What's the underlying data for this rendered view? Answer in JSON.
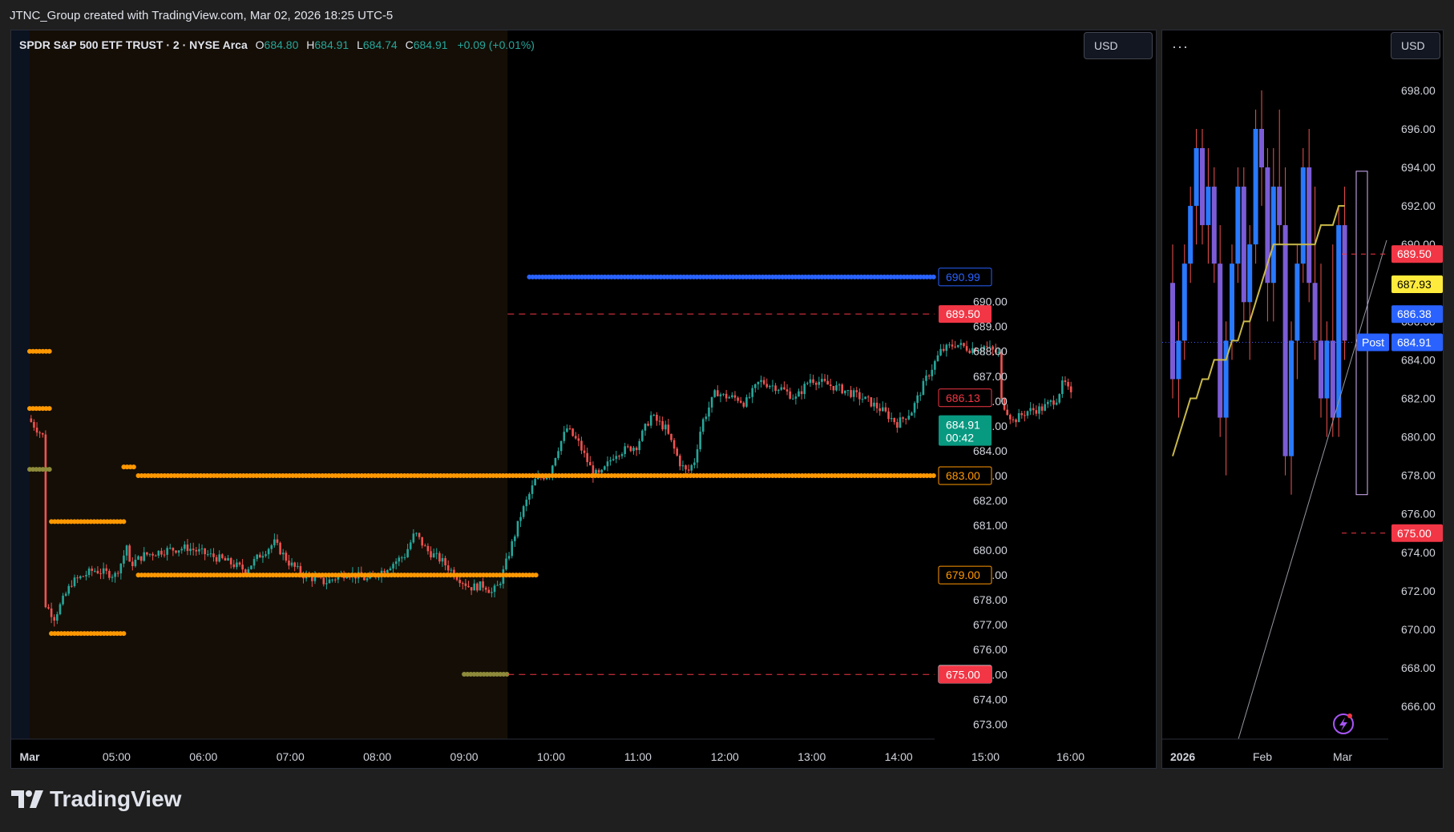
{
  "header": {
    "attribution": "JTNC_Group created with TradingView.com, Mar 02, 2026 18:25 UTC-5"
  },
  "main": {
    "symbol": "SPDR S&P 500 ETF TRUST · 2 · NYSE Arca",
    "o_label": "O",
    "o_value": "684.80",
    "h_label": "H",
    "h_value": "684.91",
    "l_label": "L",
    "l_value": "684.74",
    "c_label": "C",
    "c_value": "684.91",
    "change": "+0.09 (+0.01%)",
    "currency": "USD"
  },
  "side": {
    "menu": "···",
    "currency": "USD"
  },
  "footer": {
    "brand": "TradingView"
  },
  "colors": {
    "up": "#26a69a",
    "down": "#ef5350",
    "orange": "#ff9800",
    "blue": "#2962ff",
    "olive": "#8d8a3a",
    "red_label": "#f23645",
    "green_label": "#089981",
    "premarket_bg": "#140e06",
    "side_up": "#2979ff",
    "side_down": "#7b5cd6",
    "ma": "#c9b94a"
  },
  "chart_data": [
    {
      "type": "candlestick",
      "interval": "2",
      "ylim": [
        672.4,
        700.2
      ],
      "x_range": [
        "04:00",
        "16:00"
      ],
      "x_ticks": [
        "Mar",
        "05:00",
        "06:00",
        "07:00",
        "08:00",
        "09:00",
        "10:00",
        "11:00",
        "12:00",
        "13:00",
        "14:00",
        "15:00",
        "16:00"
      ],
      "y_ticks": [
        673,
        674,
        675,
        676,
        677,
        678,
        679,
        680,
        681,
        682,
        683,
        684,
        685,
        686,
        687,
        688,
        689,
        690
      ],
      "y_tick_labels": [
        "673.00",
        "674.00",
        "675.00",
        "676.00",
        "677.00",
        "678.00",
        "679.00",
        "680.00",
        "681.00",
        "682.00",
        "683.00",
        "684.00",
        "685.00",
        "686.00",
        "687.00",
        "688.00",
        "689.00",
        "690.00"
      ],
      "premarket_until": "09:30",
      "price_path": [
        [
          "04:00",
          685.3
        ],
        [
          "04:10",
          684.6
        ],
        [
          "04:12",
          677.8
        ],
        [
          "04:18",
          677.3
        ],
        [
          "04:30",
          678.7
        ],
        [
          "04:45",
          679.2
        ],
        [
          "05:00",
          679.0
        ],
        [
          "05:05",
          679.6
        ],
        [
          "05:08",
          680.2
        ],
        [
          "05:10",
          679.4
        ],
        [
          "05:20",
          679.8
        ],
        [
          "05:35",
          680.0
        ],
        [
          "05:50",
          680.1
        ],
        [
          "06:00",
          679.9
        ],
        [
          "06:15",
          679.6
        ],
        [
          "06:30",
          679.2
        ],
        [
          "06:40",
          679.8
        ],
        [
          "06:50",
          680.3
        ],
        [
          "07:00",
          679.5
        ],
        [
          "07:10",
          679.0
        ],
        [
          "07:25",
          678.7
        ],
        [
          "07:40",
          679.1
        ],
        [
          "07:55",
          678.8
        ],
        [
          "08:10",
          679.4
        ],
        [
          "08:20",
          679.8
        ],
        [
          "08:27",
          680.7
        ],
        [
          "08:35",
          680.0
        ],
        [
          "08:45",
          679.6
        ],
        [
          "08:55",
          679.0
        ],
        [
          "09:05",
          678.5
        ],
        [
          "09:15",
          678.6
        ],
        [
          "09:20",
          678.3
        ],
        [
          "09:25",
          678.6
        ],
        [
          "09:30",
          679.5
        ],
        [
          "09:40",
          681.4
        ],
        [
          "09:50",
          682.8
        ],
        [
          "10:00",
          683.1
        ],
        [
          "10:05",
          684.0
        ],
        [
          "10:12",
          684.9
        ],
        [
          "10:20",
          684.3
        ],
        [
          "10:30",
          683.1
        ],
        [
          "10:35",
          683.0
        ],
        [
          "10:45",
          683.9
        ],
        [
          "11:00",
          684.2
        ],
        [
          "11:10",
          685.4
        ],
        [
          "11:20",
          684.9
        ],
        [
          "11:30",
          683.5
        ],
        [
          "11:35",
          683.1
        ],
        [
          "11:40",
          683.6
        ],
        [
          "11:45",
          685.1
        ],
        [
          "11:55",
          686.4
        ],
        [
          "12:00",
          686.2
        ],
        [
          "12:10",
          686.1
        ],
        [
          "12:15",
          685.9
        ],
        [
          "12:25",
          686.8
        ],
        [
          "12:40",
          686.5
        ],
        [
          "12:50",
          686.1
        ],
        [
          "13:00",
          686.9
        ],
        [
          "13:10",
          686.7
        ],
        [
          "13:25",
          686.4
        ],
        [
          "13:40",
          686.0
        ],
        [
          "13:50",
          685.6
        ],
        [
          "14:00",
          685.1
        ],
        [
          "14:10",
          685.6
        ],
        [
          "14:20",
          686.9
        ],
        [
          "14:30",
          688.0
        ],
        [
          "14:40",
          688.3
        ],
        [
          "14:50",
          688.1
        ],
        [
          "15:00",
          688.2
        ],
        [
          "15:10",
          687.9
        ],
        [
          "15:12",
          686.0
        ],
        [
          "15:20",
          685.2
        ],
        [
          "15:30",
          685.6
        ],
        [
          "15:40",
          685.7
        ],
        [
          "15:50",
          686.1
        ],
        [
          "15:55",
          686.8
        ],
        [
          "16:00",
          686.2
        ]
      ],
      "levels": [
        {
          "price": 690.99,
          "label": "690.99",
          "style": "dots",
          "color": "blue",
          "from": "09:45",
          "to": "16:00"
        },
        {
          "price": 689.5,
          "label": "689.50",
          "style": "dashed",
          "color": "red",
          "from": "09:30",
          "to": "16:00"
        },
        {
          "price": 683.0,
          "label": "683.00",
          "style": "dots",
          "color": "orange",
          "from": "05:15",
          "to": "16:00"
        },
        {
          "price": 679.0,
          "label": "679.00",
          "style": "dots",
          "color": "orange",
          "from": "05:15",
          "to": "09:50"
        },
        {
          "price": 675.01,
          "label": "675.01",
          "style": "dots",
          "color": "olive",
          "from": "09:00",
          "to": "09:30"
        },
        {
          "price": 675.0,
          "label": "675.00",
          "style": "dashed",
          "color": "red",
          "from": "09:30",
          "to": "16:00"
        },
        {
          "price": 688.0,
          "style": "dots",
          "color": "orange",
          "from": "04:00",
          "to": "04:15"
        },
        {
          "price": 685.7,
          "style": "dots",
          "color": "orange",
          "from": "04:00",
          "to": "04:15"
        },
        {
          "price": 683.25,
          "style": "dots",
          "color": "olive",
          "from": "04:00",
          "to": "04:15"
        },
        {
          "price": 683.35,
          "style": "dots",
          "color": "orange",
          "from": "05:05",
          "to": "05:12"
        },
        {
          "price": 681.15,
          "style": "dots",
          "color": "orange",
          "from": "04:15",
          "to": "05:05"
        },
        {
          "price": 676.65,
          "style": "dots",
          "color": "orange",
          "from": "04:15",
          "to": "05:05"
        }
      ],
      "price_labels": [
        {
          "value": "686.13",
          "kind": "outline-red"
        },
        {
          "value": "684.91",
          "sub": "00:42",
          "kind": "current"
        }
      ]
    },
    {
      "type": "candlestick",
      "interval": "1D",
      "ylim": [
        664.3,
        700.2
      ],
      "x_ticks": [
        "2026",
        "Feb",
        "Mar"
      ],
      "y_ticks": [
        666,
        668,
        670,
        672,
        674,
        676,
        678,
        680,
        682,
        684,
        686,
        688,
        690,
        692,
        694,
        696,
        698
      ],
      "y_tick_labels": [
        "666.00",
        "668.00",
        "670.00",
        "672.00",
        "674.00",
        "676.00",
        "678.00",
        "680.00",
        "682.00",
        "684.00",
        "686.00",
        "688.00",
        "690.00",
        "692.00",
        "694.00",
        "696.00",
        "698.00"
      ],
      "candles": [
        [
          688,
          690,
          682,
          683
        ],
        [
          683,
          686,
          681,
          685
        ],
        [
          685,
          690,
          684,
          689
        ],
        [
          689,
          693,
          688,
          692
        ],
        [
          692,
          696,
          690,
          695
        ],
        [
          695,
          696,
          690,
          691
        ],
        [
          691,
          695,
          689,
          693
        ],
        [
          693,
          694,
          688,
          689
        ],
        [
          689,
          691,
          680,
          681
        ],
        [
          681,
          686,
          678,
          685
        ],
        [
          685,
          690,
          684,
          689
        ],
        [
          689,
          694,
          688,
          693
        ],
        [
          693,
          694,
          686,
          687
        ],
        [
          687,
          691,
          684,
          690
        ],
        [
          690,
          697,
          689,
          696
        ],
        [
          696,
          698,
          692,
          694
        ],
        [
          694,
          695,
          686,
          688
        ],
        [
          688,
          695,
          686,
          693
        ],
        [
          693,
          697,
          690,
          691
        ],
        [
          691,
          694,
          678,
          679
        ],
        [
          679,
          686,
          677,
          685
        ],
        [
          685,
          690,
          683,
          689
        ],
        [
          689,
          695,
          688,
          694
        ],
        [
          694,
          696,
          687,
          688
        ],
        [
          688,
          693,
          684,
          685
        ],
        [
          685,
          689,
          681,
          682
        ],
        [
          682,
          686,
          680,
          685
        ],
        [
          685,
          690,
          680,
          681
        ],
        [
          681,
          692,
          680,
          691
        ],
        [
          691,
          693,
          684,
          685
        ]
      ],
      "ma": [
        679,
        680,
        681,
        682,
        682,
        683,
        683,
        684,
        684,
        684,
        685,
        685,
        686,
        686,
        687,
        688,
        689,
        690,
        690,
        690,
        690,
        690,
        690,
        690,
        690,
        691,
        691,
        691,
        692,
        692
      ],
      "levels": [
        {
          "price": 689.5,
          "label": "689.50",
          "style": "dashed",
          "color": "red"
        },
        {
          "price": 675.0,
          "label": "675.00",
          "style": "dashed",
          "color": "red"
        },
        {
          "price": 684.91,
          "style": "dotted",
          "color": "blue"
        }
      ],
      "price_labels": [
        {
          "value": "687.93",
          "kind": "yellow"
        },
        {
          "value": "686.38",
          "kind": "blue"
        },
        {
          "value": "684.91",
          "kind": "blue",
          "tag": "Post"
        }
      ],
      "postmarket_box": {
        "high": 693.8,
        "low": 677.0
      }
    }
  ]
}
